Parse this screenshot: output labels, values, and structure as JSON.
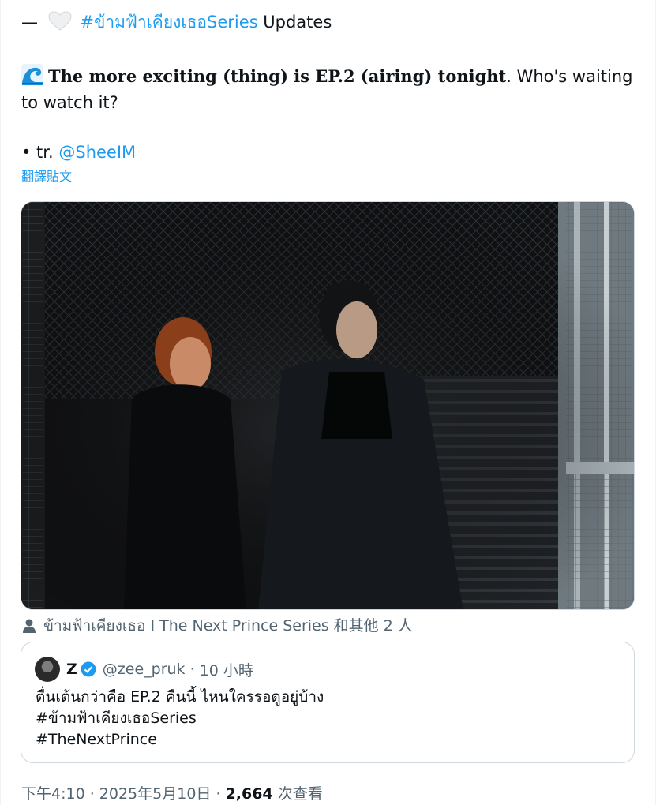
{
  "tweet": {
    "intro_dash": "—",
    "hashtag_series_thai": "#ข้ามฟ้าเคียงเธอSeries",
    "updates_word": "Updates",
    "highlight_text": "The more exciting (thing) is EP.2 (airing) tonight",
    "highlight_period": ".",
    "rest_text": " Who's waiting to watch it?",
    "tr_prefix": "• tr.",
    "tr_handle": "@SheeIM",
    "translate_link": "翻譯貼文",
    "tagged": "ข้ามฟ้าเคียงเธอ I The Next Prince Series 和其他 2 人",
    "icons": [
      "heart-icon",
      "wave-icon",
      "person-icon",
      "verified-badge-icon"
    ],
    "colors": {
      "link": "#1d9bf0",
      "secondary": "#536471",
      "text": "#0f1419"
    }
  },
  "quote": {
    "avatar_alt": "zee_pruk avatar",
    "name": "Z",
    "handle": "@zee_pruk",
    "sep": "·",
    "time": "10 小時",
    "line1": "ตื่นเต้นกว่าคือ EP.2 คืนนี้ ไหนใครรอดูอยู่บ้าง",
    "line2": "#ข้ามฟ้าเคียงเธอSeries",
    "line3": "#TheNextPrince"
  },
  "footer": {
    "time": "下午4:10",
    "sep1": " · ",
    "date": "2025年5月10日",
    "sep2": " · ",
    "views": "2,664",
    "views_label": " 次查看"
  }
}
